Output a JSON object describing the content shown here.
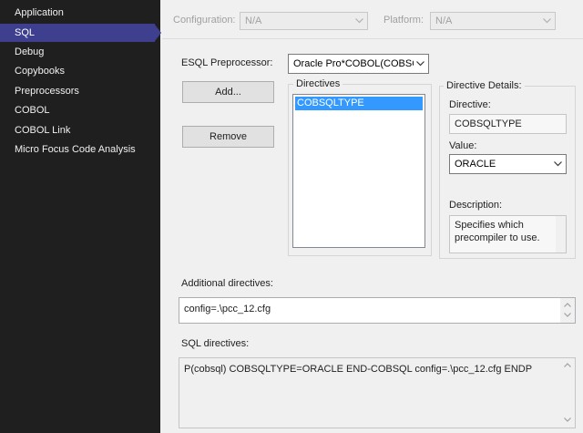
{
  "nav": {
    "items": [
      "Application",
      "SQL",
      "Debug",
      "Copybooks",
      "Preprocessors",
      "COBOL",
      "COBOL Link",
      "Micro Focus Code Analysis"
    ],
    "active": "SQL"
  },
  "config_bar": {
    "configuration_label": "Configuration:",
    "configuration_value": "N/A",
    "platform_label": "Platform:",
    "platform_value": "N/A"
  },
  "esql": {
    "label": "ESQL Preprocessor:",
    "value": "Oracle  Pro*COBOL(COBSQL"
  },
  "buttons": {
    "add": "Add...",
    "remove": "Remove"
  },
  "directives": {
    "title": "Directives",
    "items": [
      "COBSQLTYPE"
    ],
    "selected": "COBSQLTYPE"
  },
  "details": {
    "title": "Directive Details:",
    "directive_label": "Directive:",
    "directive_value": "COBSQLTYPE",
    "value_label": "Value:",
    "value": "ORACLE",
    "description_label": "Description:",
    "description": "Specifies which precompiler to use."
  },
  "additional": {
    "label": "Additional directives:",
    "value": "config=.\\pcc_12.cfg"
  },
  "sql": {
    "label": "SQL directives:",
    "value": "P(cobsql) COBSQLTYPE=ORACLE END-COBSQL config=.\\pcc_12.cfg ENDP"
  },
  "colors": {
    "nav_bg": "#1f1f1f",
    "nav_active": "#3f3f8f",
    "selection": "#3399ff",
    "panel_bg": "#f0f0f0"
  }
}
